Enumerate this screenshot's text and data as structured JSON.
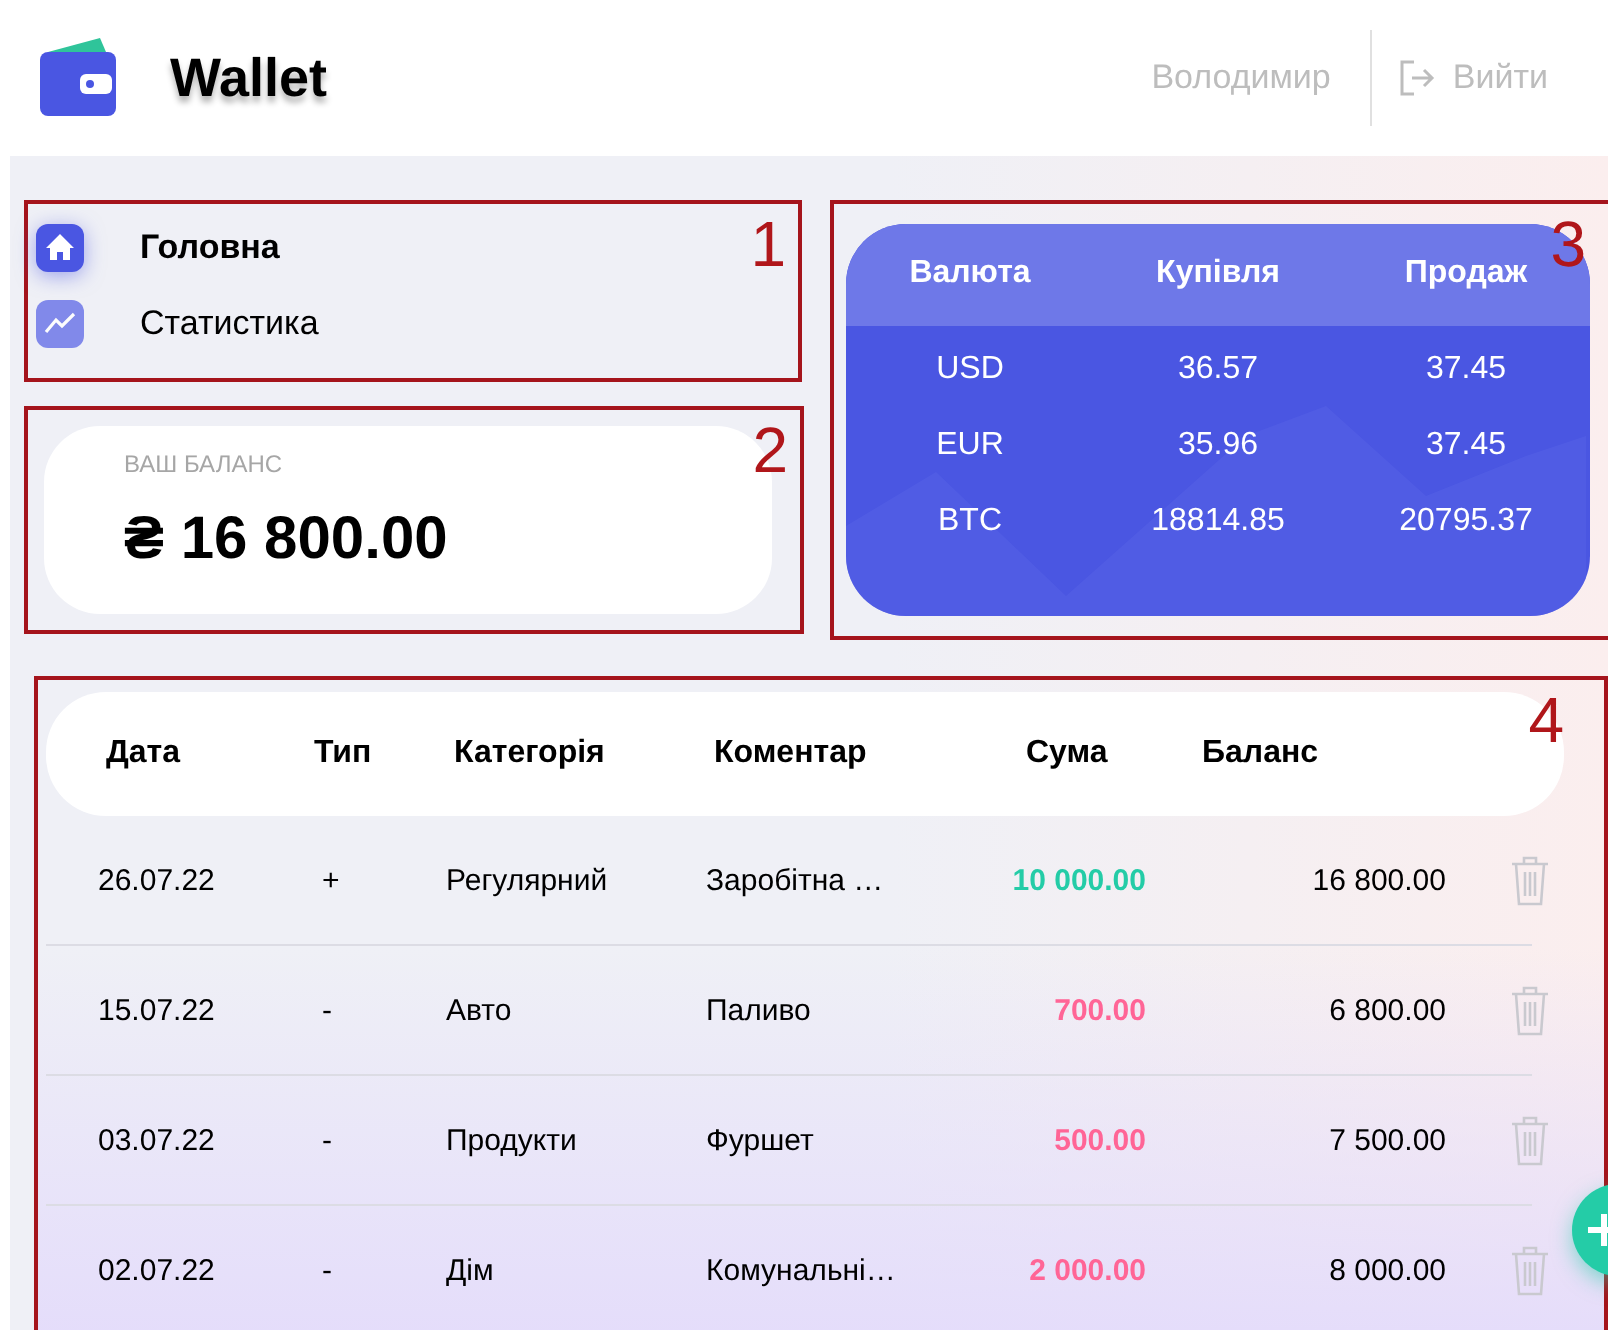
{
  "header": {
    "logo_text": "Wallet",
    "user_name": "Володимир",
    "logout_label": "Вийти"
  },
  "annotations": [
    "1",
    "2",
    "3",
    "4"
  ],
  "nav": [
    {
      "label": "Головна",
      "selected": true
    },
    {
      "label": "Статистика",
      "selected": false
    }
  ],
  "balance": {
    "label": "ВАШ БАЛАНС",
    "amount": "₴ 16 800.00"
  },
  "currency": {
    "columns": [
      "Валюта",
      "Купівля",
      "Продаж"
    ],
    "rows": [
      [
        "USD",
        "36.57",
        "37.45"
      ],
      [
        "EUR",
        "35.96",
        "37.45"
      ],
      [
        "BTC",
        "18814.85",
        "20795.37"
      ]
    ]
  },
  "table": {
    "columns": [
      "Дата",
      "Тип",
      "Категорія",
      "Коментар",
      "Сума",
      "Баланс"
    ],
    "rows": [
      {
        "date": "26.07.22",
        "type": "+",
        "category": "Регулярний",
        "comment": "Заробітна …",
        "sum": "10 000.00",
        "kind": "income",
        "balance": "16 800.00"
      },
      {
        "date": "15.07.22",
        "type": "-",
        "category": "Авто",
        "comment": "Паливо",
        "sum": "700.00",
        "kind": "expense",
        "balance": "6 800.00"
      },
      {
        "date": "03.07.22",
        "type": "-",
        "category": "Продукти",
        "comment": "Фуршет",
        "sum": "500.00",
        "kind": "expense",
        "balance": "7 500.00"
      },
      {
        "date": "02.07.22",
        "type": "-",
        "category": "Дім",
        "comment": "Комунальні…",
        "sum": "2 000.00",
        "kind": "expense",
        "balance": "8 000.00"
      }
    ]
  }
}
